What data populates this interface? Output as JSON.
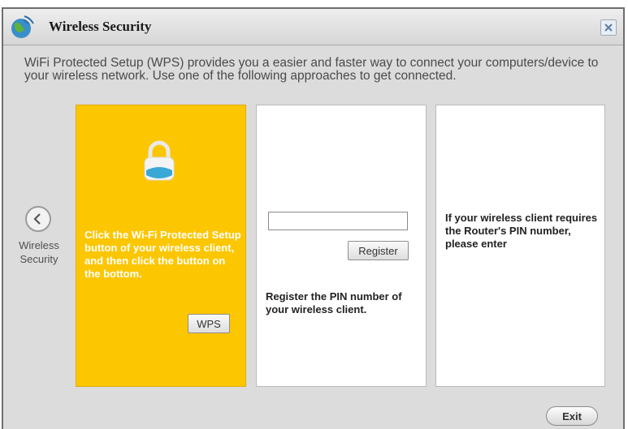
{
  "window": {
    "title": "Wireless Security",
    "icon": "wireless-globe-icon",
    "close_icon": "close-icon"
  },
  "intro_text": "WiFi Protected Setup (WPS) provides you a easier and faster way to connect your computers/device to your wireless network. Use one of the following approaches to get connected.",
  "nav": {
    "back_icon": "chevron-left-icon",
    "back_label": "Wireless Security"
  },
  "panels": [
    {
      "text": "Click the Wi-Fi Protected Setup button of your wireless client, and then click the button on the bottom.",
      "icon": "lock-icon",
      "button_label": "WPS",
      "background": "#fcc601"
    },
    {
      "input_value": "",
      "button_label": "Register",
      "text": "Register the PIN number of your wireless client."
    },
    {
      "text": "If your wireless client requires the Router's PIN number, please enter"
    }
  ],
  "footer": {
    "exit_label": "Exit"
  }
}
